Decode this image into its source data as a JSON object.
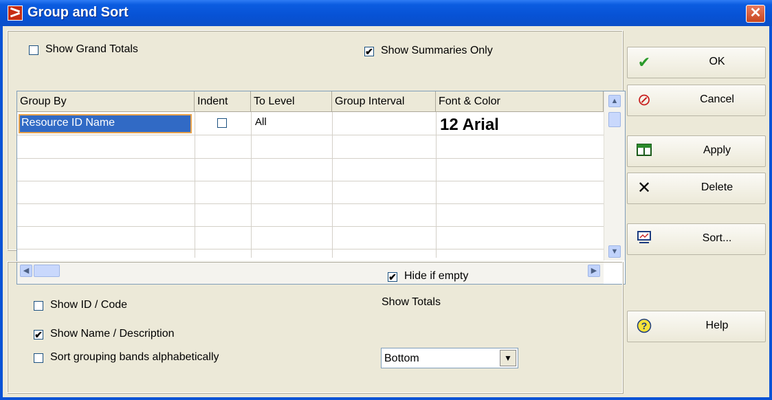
{
  "window": {
    "title": "Group and Sort",
    "close_glyph": "✕"
  },
  "options": {
    "show_grand_totals": {
      "label": "Show Grand Totals",
      "checked": false
    },
    "show_summaries_only": {
      "label": "Show Summaries Only",
      "checked": true
    }
  },
  "grid": {
    "columns": [
      "Group By",
      "Indent",
      "To Level",
      "Group Interval",
      "Font & Color"
    ],
    "rows": [
      {
        "group_by": "Resource ID Name",
        "indent": false,
        "to_level": "All",
        "group_interval": "",
        "font_color": "12 Arial"
      }
    ]
  },
  "bottom": {
    "hide_if_empty": {
      "label": "Hide if empty",
      "checked": true
    },
    "show_id_code": {
      "label": "Show ID / Code",
      "checked": false
    },
    "show_name_description": {
      "label": "Show Name / Description",
      "checked": true
    },
    "sort_alpha": {
      "label": "Sort grouping bands alphabetically",
      "checked": false
    },
    "show_totals_label": "Show Totals",
    "show_totals_value": "Bottom"
  },
  "buttons": {
    "ok": {
      "label": "OK",
      "icon": "checkmark-icon"
    },
    "cancel": {
      "label": "Cancel",
      "icon": "cancel-icon"
    },
    "apply": {
      "label": "Apply",
      "icon": "apply-icon"
    },
    "delete": {
      "label": "Delete",
      "icon": "x-icon"
    },
    "sort": {
      "label": "Sort...",
      "icon": "sort-icon"
    },
    "help": {
      "label": "Help",
      "icon": "help-icon"
    }
  },
  "colors": {
    "titlebar": "#0a53d6",
    "selected_cell": "#316ac5",
    "cell_focus": "#e8a24b"
  }
}
